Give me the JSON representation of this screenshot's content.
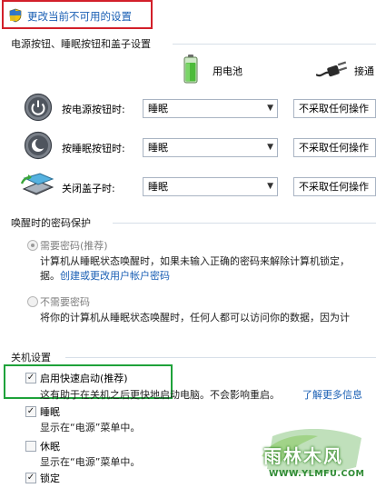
{
  "top_link": {
    "label": "更改当前不可用的设置",
    "icon": "uac-shield-icon"
  },
  "power_buttons": {
    "title": "电源按钮、睡眠按钮和盖子设置",
    "columns": {
      "battery": "用电池",
      "plugged": "接通"
    },
    "rows": [
      {
        "icon": "power-button-icon",
        "label": "按电源按钮时:",
        "battery": "睡眠",
        "plugged": "不采取任何操作"
      },
      {
        "icon": "sleep-button-icon",
        "label": "按睡眠按钮时:",
        "battery": "睡眠",
        "plugged": "不采取任何操作"
      },
      {
        "icon": "close-lid-icon",
        "label": "关闭盖子时:",
        "battery": "睡眠",
        "plugged": "不采取任何操作"
      }
    ]
  },
  "wake_password": {
    "title": "唤醒时的密码保护",
    "require": {
      "label": "需要密码(推荐)",
      "desc1": "计算机从睡眠状态唤醒时，如果未输入正确的密码来解除计算机锁定，",
      "desc2": "据。",
      "link": "创建或更改用户帐户密码",
      "selected": true
    },
    "no_require": {
      "label": "不需要密码",
      "desc": "将你的计算机从睡眠状态唤醒时，任何人都可以访问你的数据，因为计",
      "selected": false
    }
  },
  "shutdown": {
    "title": "关机设置",
    "items": [
      {
        "label": "启用快速启动(推荐)",
        "checked": true,
        "desc": "这有助于在关机之后更快地启动电脑。不会影响重启。",
        "link": "了解更多信息"
      },
      {
        "label": "睡眠",
        "checked": true,
        "desc": "显示在“电源”菜单中。"
      },
      {
        "label": "休眠",
        "checked": false,
        "desc": "显示在“电源”菜单中。"
      },
      {
        "label": "锁定",
        "checked": true
      }
    ]
  },
  "watermark": {
    "brand": "雨林木风",
    "url": "WWW.YLMFU.COM"
  },
  "colors": {
    "link": "#1a5fb4",
    "red_highlight": "#d21f2a",
    "green_highlight": "#1ea23a",
    "rule": "#d7dfe8"
  }
}
